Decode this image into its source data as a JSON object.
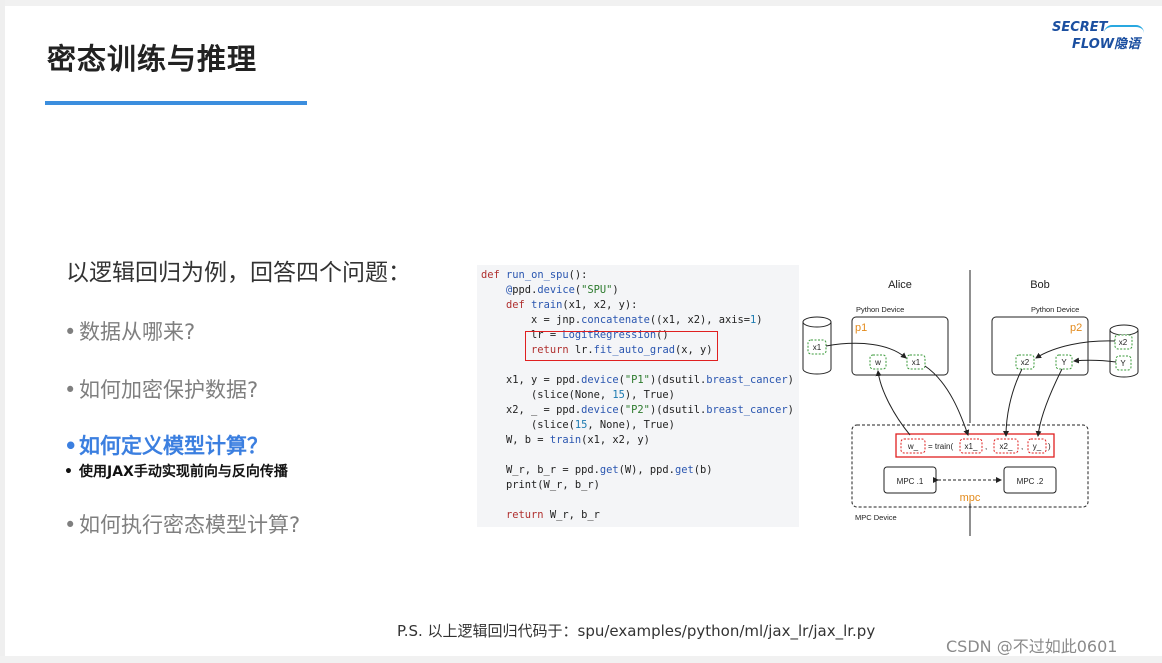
{
  "slide": {
    "title": "密态训练与推理",
    "logo": {
      "line1": "SECRET",
      "line2": "FLOW隐语"
    },
    "intro": "以逻辑回归为例，回答四个问题：",
    "questions": [
      "数据从哪来?",
      "如何加密保护数据?",
      "如何定义模型计算？",
      "如何执行密态模型计算?"
    ],
    "highlight_sub": "使用JAX手动实现前向与反向传播",
    "bullet": "•",
    "footnote": "P.S. 以上逻辑回归代码于：spu/examples/python/ml/jax_lr/jax_lr.py",
    "watermark": "CSDN @不过如此0601",
    "colors": {
      "accent": "#3b8ede",
      "highlight": "#3b7fe0",
      "box_red": "#e02020",
      "device_green": "#3a9a3a"
    }
  },
  "code": {
    "lines": [
      "def run_on_spu():",
      "    @ppd.device(\"SPU\")",
      "    def train(x1, x2, y):",
      "        x = jnp.concatenate((x1, x2), axis=1)",
      "        lr = LogitRegression()",
      "        return lr.fit_auto_grad(x, y)",
      "",
      "    x1, y = ppd.device(\"P1\")(dsutil.breast_cancer)",
      "        (slice(None, 15), True)",
      "    x2, _ = ppd.device(\"P2\")(dsutil.breast_cancer)",
      "        (slice(15, None), True)",
      "    W, b = train(x1, x2, y)",
      "",
      "    W_r, b_r = ppd.get(W), ppd.get(b)",
      "    print(W_r, b_r)",
      "",
      "    return W_r, b_r"
    ]
  },
  "diagram": {
    "alice": "Alice",
    "bob": "Bob",
    "python_device": "Python Device",
    "p1": "p1",
    "p2": "p2",
    "x1": "x1",
    "x2": "x2",
    "w": "w",
    "y_upper": "Y",
    "train_prefix": "= train(",
    "w_": "w_",
    "x1_": "x1_",
    "x2_": "x2_",
    "y_": "y_",
    "comma": ",",
    "close_paren": ")",
    "mpc1": "MPC .1",
    "mpc2": "MPC .2",
    "mpc": "mpc",
    "mpc_device": "MPC Device"
  }
}
